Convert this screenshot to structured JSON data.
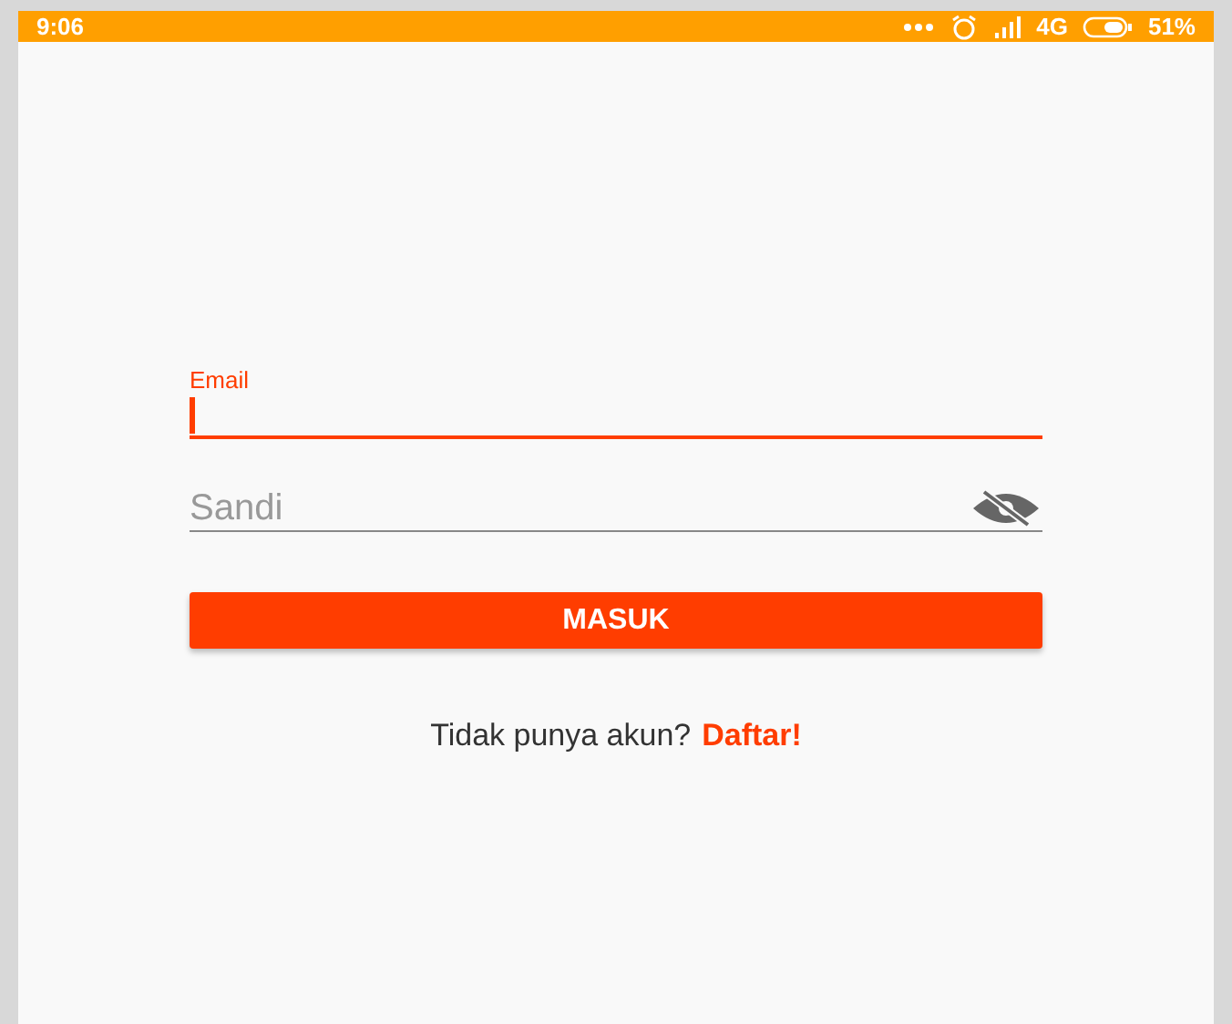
{
  "status_bar": {
    "time": "9:06",
    "network": "4G",
    "battery": "51%"
  },
  "email_field": {
    "label": "Email",
    "focused": true
  },
  "password_field": {
    "placeholder": "Sandi",
    "focused": false
  },
  "login_button": "MASUK",
  "signup_prompt": {
    "text": "Tidak punya akun?",
    "link": "Daftar!"
  }
}
